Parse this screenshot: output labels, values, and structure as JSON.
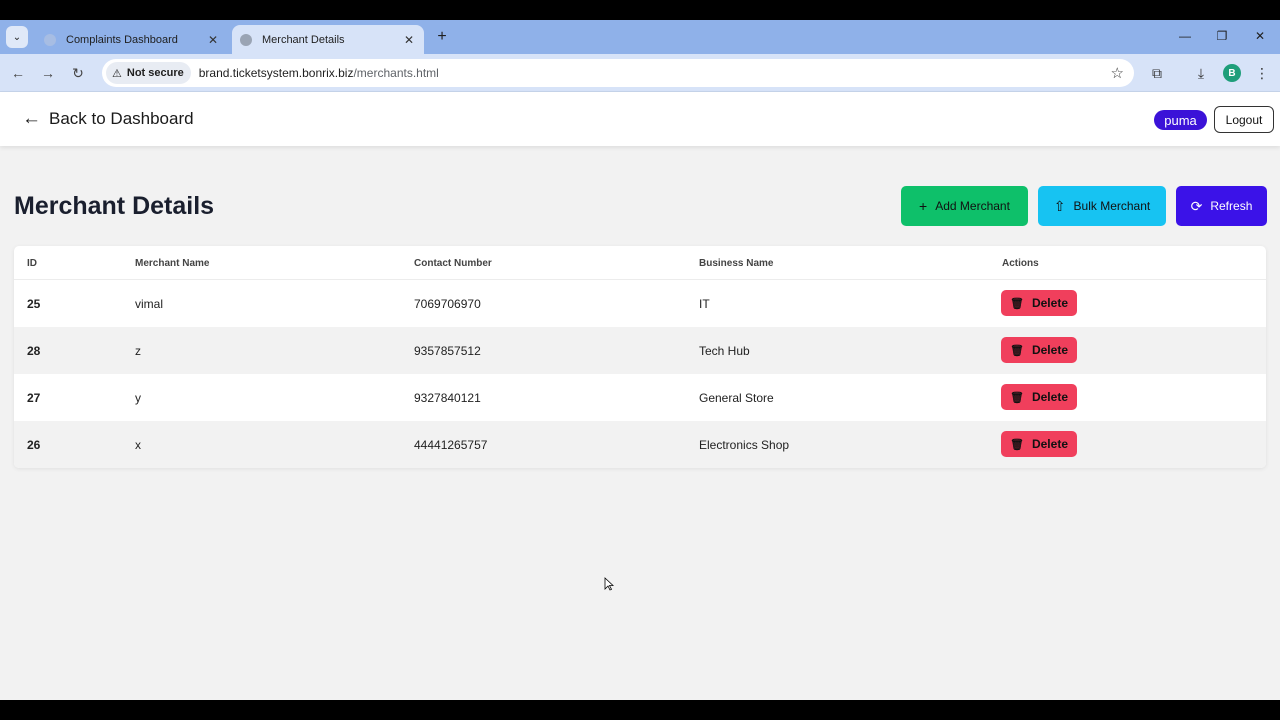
{
  "browser": {
    "tabs": [
      {
        "label": "Complaints Dashboard"
      },
      {
        "label": "Merchant Details"
      }
    ],
    "security_label": "Not secure",
    "url_host": "brand.ticketsystem.bonrix.biz",
    "url_path": "/merchants.html",
    "profile_initial": "B"
  },
  "header": {
    "back_label": "Back to Dashboard",
    "user_badge": "puma",
    "logout_label": "Logout"
  },
  "main": {
    "title": "Merchant Details",
    "add_label": "Add Merchant",
    "bulk_label": "Bulk Merchant",
    "refresh_label": "Refresh"
  },
  "table": {
    "columns": [
      "ID",
      "Merchant Name",
      "Contact Number",
      "Business Name",
      "Actions"
    ],
    "rows": [
      {
        "id": "25",
        "name": "vimal",
        "contact": "7069706970",
        "business": "IT",
        "action": "Delete"
      },
      {
        "id": "28",
        "name": "z",
        "contact": "9357857512",
        "business": "Tech Hub",
        "action": "Delete"
      },
      {
        "id": "27",
        "name": "y",
        "contact": "9327840121",
        "business": "General Store",
        "action": "Delete"
      },
      {
        "id": "26",
        "name": "x",
        "contact": "44441265757",
        "business": "Electronics Shop",
        "action": "Delete"
      }
    ]
  },
  "colors": {
    "tabstrip": "#8fb1e9",
    "add": "#0ec06a",
    "bulk": "#17c3f2",
    "refresh": "#3b12e8",
    "delete": "#f03f5c",
    "badge": "#3b12d8"
  }
}
